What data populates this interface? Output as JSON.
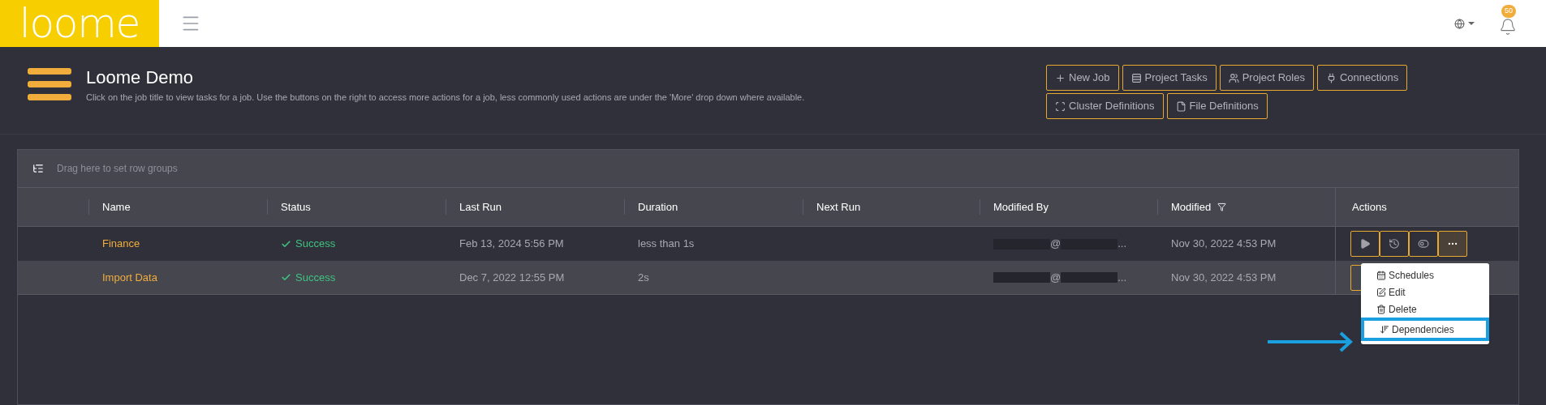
{
  "topbar": {
    "logo": "loome",
    "notifications": {
      "count": "50"
    }
  },
  "page": {
    "title": "Loome Demo",
    "description": "Click on the job title to view tasks for a job. Use the buttons on the right to access more actions for a job, less commonly used actions are under the 'More' drop down where available.",
    "buttons": [
      {
        "kind": "plus",
        "label": "New Job"
      },
      {
        "kind": "tasks",
        "label": "Project Tasks"
      },
      {
        "kind": "users",
        "label": "Project Roles"
      },
      {
        "kind": "plug",
        "label": "Connections"
      },
      {
        "kind": "cluster",
        "label": "Cluster Definitions"
      },
      {
        "kind": "file",
        "label": "File Definitions"
      }
    ]
  },
  "grid": {
    "group_placeholder": "Drag here to set row groups",
    "columns": [
      {
        "label": "Name",
        "kind": "plain"
      },
      {
        "label": "Status",
        "kind": "plain"
      },
      {
        "label": "Last Run",
        "kind": "plain"
      },
      {
        "label": "Duration",
        "kind": "plain"
      },
      {
        "label": "Next Run",
        "kind": "plain"
      },
      {
        "label": "Modified By",
        "kind": "plain"
      },
      {
        "label": "Modified",
        "kind": "filtered"
      },
      {
        "label": "Actions",
        "kind": "plain"
      }
    ],
    "rows": [
      {
        "name": "Finance",
        "status": "Success",
        "last_run": "Feb 13, 2024 5:56 PM",
        "duration": "less than 1s",
        "modified_by_at": "@",
        "modified_by_tail": "...",
        "modified": "Nov 30, 2022 4:53 PM",
        "actions": [
          {
            "kind": "run",
            "open": false
          },
          {
            "kind": "history",
            "open": false
          },
          {
            "kind": "toggle",
            "open": false
          },
          {
            "kind": "more",
            "open": true
          }
        ]
      },
      {
        "name": "Import Data",
        "status": "Success",
        "last_run": "Dec 7, 2022 12:55 PM",
        "duration": "2s",
        "modified_by_at": "@",
        "modified_by_tail": "...",
        "modified": "Nov 30, 2022 4:53 PM"
      }
    ],
    "menu": [
      {
        "kind": "calendar",
        "label": "Schedules",
        "highlighted": false
      },
      {
        "kind": "edit",
        "label": "Edit",
        "highlighted": false
      },
      {
        "kind": "delete",
        "label": "Delete",
        "highlighted": false
      },
      {
        "kind": "dependencies",
        "label": "Dependencies",
        "highlighted": true
      }
    ]
  }
}
